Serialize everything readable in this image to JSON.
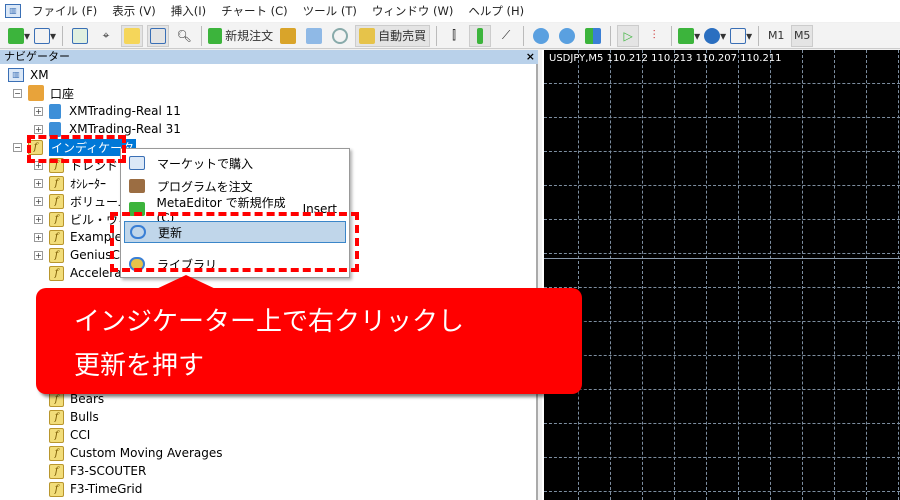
{
  "menubar": {
    "items": [
      "ファイル (F)",
      "表示 (V)",
      "挿入(I)",
      "チャート (C)",
      "ツール (T)",
      "ウィンドウ (W)",
      "ヘルプ (H)"
    ]
  },
  "toolbar": {
    "new_order": "新規注文",
    "auto_trade": "自動売買",
    "timeframes": [
      "M1",
      "M5"
    ]
  },
  "navigator": {
    "title": "ナビゲーター",
    "close": "×",
    "root": "XM",
    "accounts_label": "口座",
    "accounts": [
      "XMTrading-Real 11",
      "XMTrading-Real 31"
    ],
    "indicators_label": "インディケータ",
    "folders": [
      "トレンド",
      "ｵｼﾚｰﾀｰ",
      "ボリューム",
      "ビル・ウィリアムス",
      "Examples",
      "GeniusCharts"
    ],
    "items_top": [
      "Accelerator"
    ],
    "items_bottom": [
      "Bears",
      "Bulls",
      "CCI",
      "Custom Moving Averages",
      "F3-SCOUTER",
      "F3-TimeGrid"
    ]
  },
  "chart": {
    "header": "USDJPY,M5  110.212 110.213 110.207 110.211",
    "background": "#000000",
    "grid": "#7d8ea0"
  },
  "context_menu": {
    "items": [
      {
        "label": "マーケットで購入",
        "icon": "market-icon"
      },
      {
        "label": "プログラムを注文",
        "icon": "briefcase-icon"
      },
      {
        "label": "MetaEditor で新規作成 (C)",
        "shortcut": "Insert",
        "icon": "plus-icon"
      },
      {
        "label": "更新",
        "icon": "refresh-icon"
      },
      {
        "label": "ライブラリ",
        "icon": "globe-icon"
      }
    ]
  },
  "callout": {
    "line1": "インジケーター上で右クリックし",
    "line2": "更新を押す",
    "color": "#ff0000"
  }
}
